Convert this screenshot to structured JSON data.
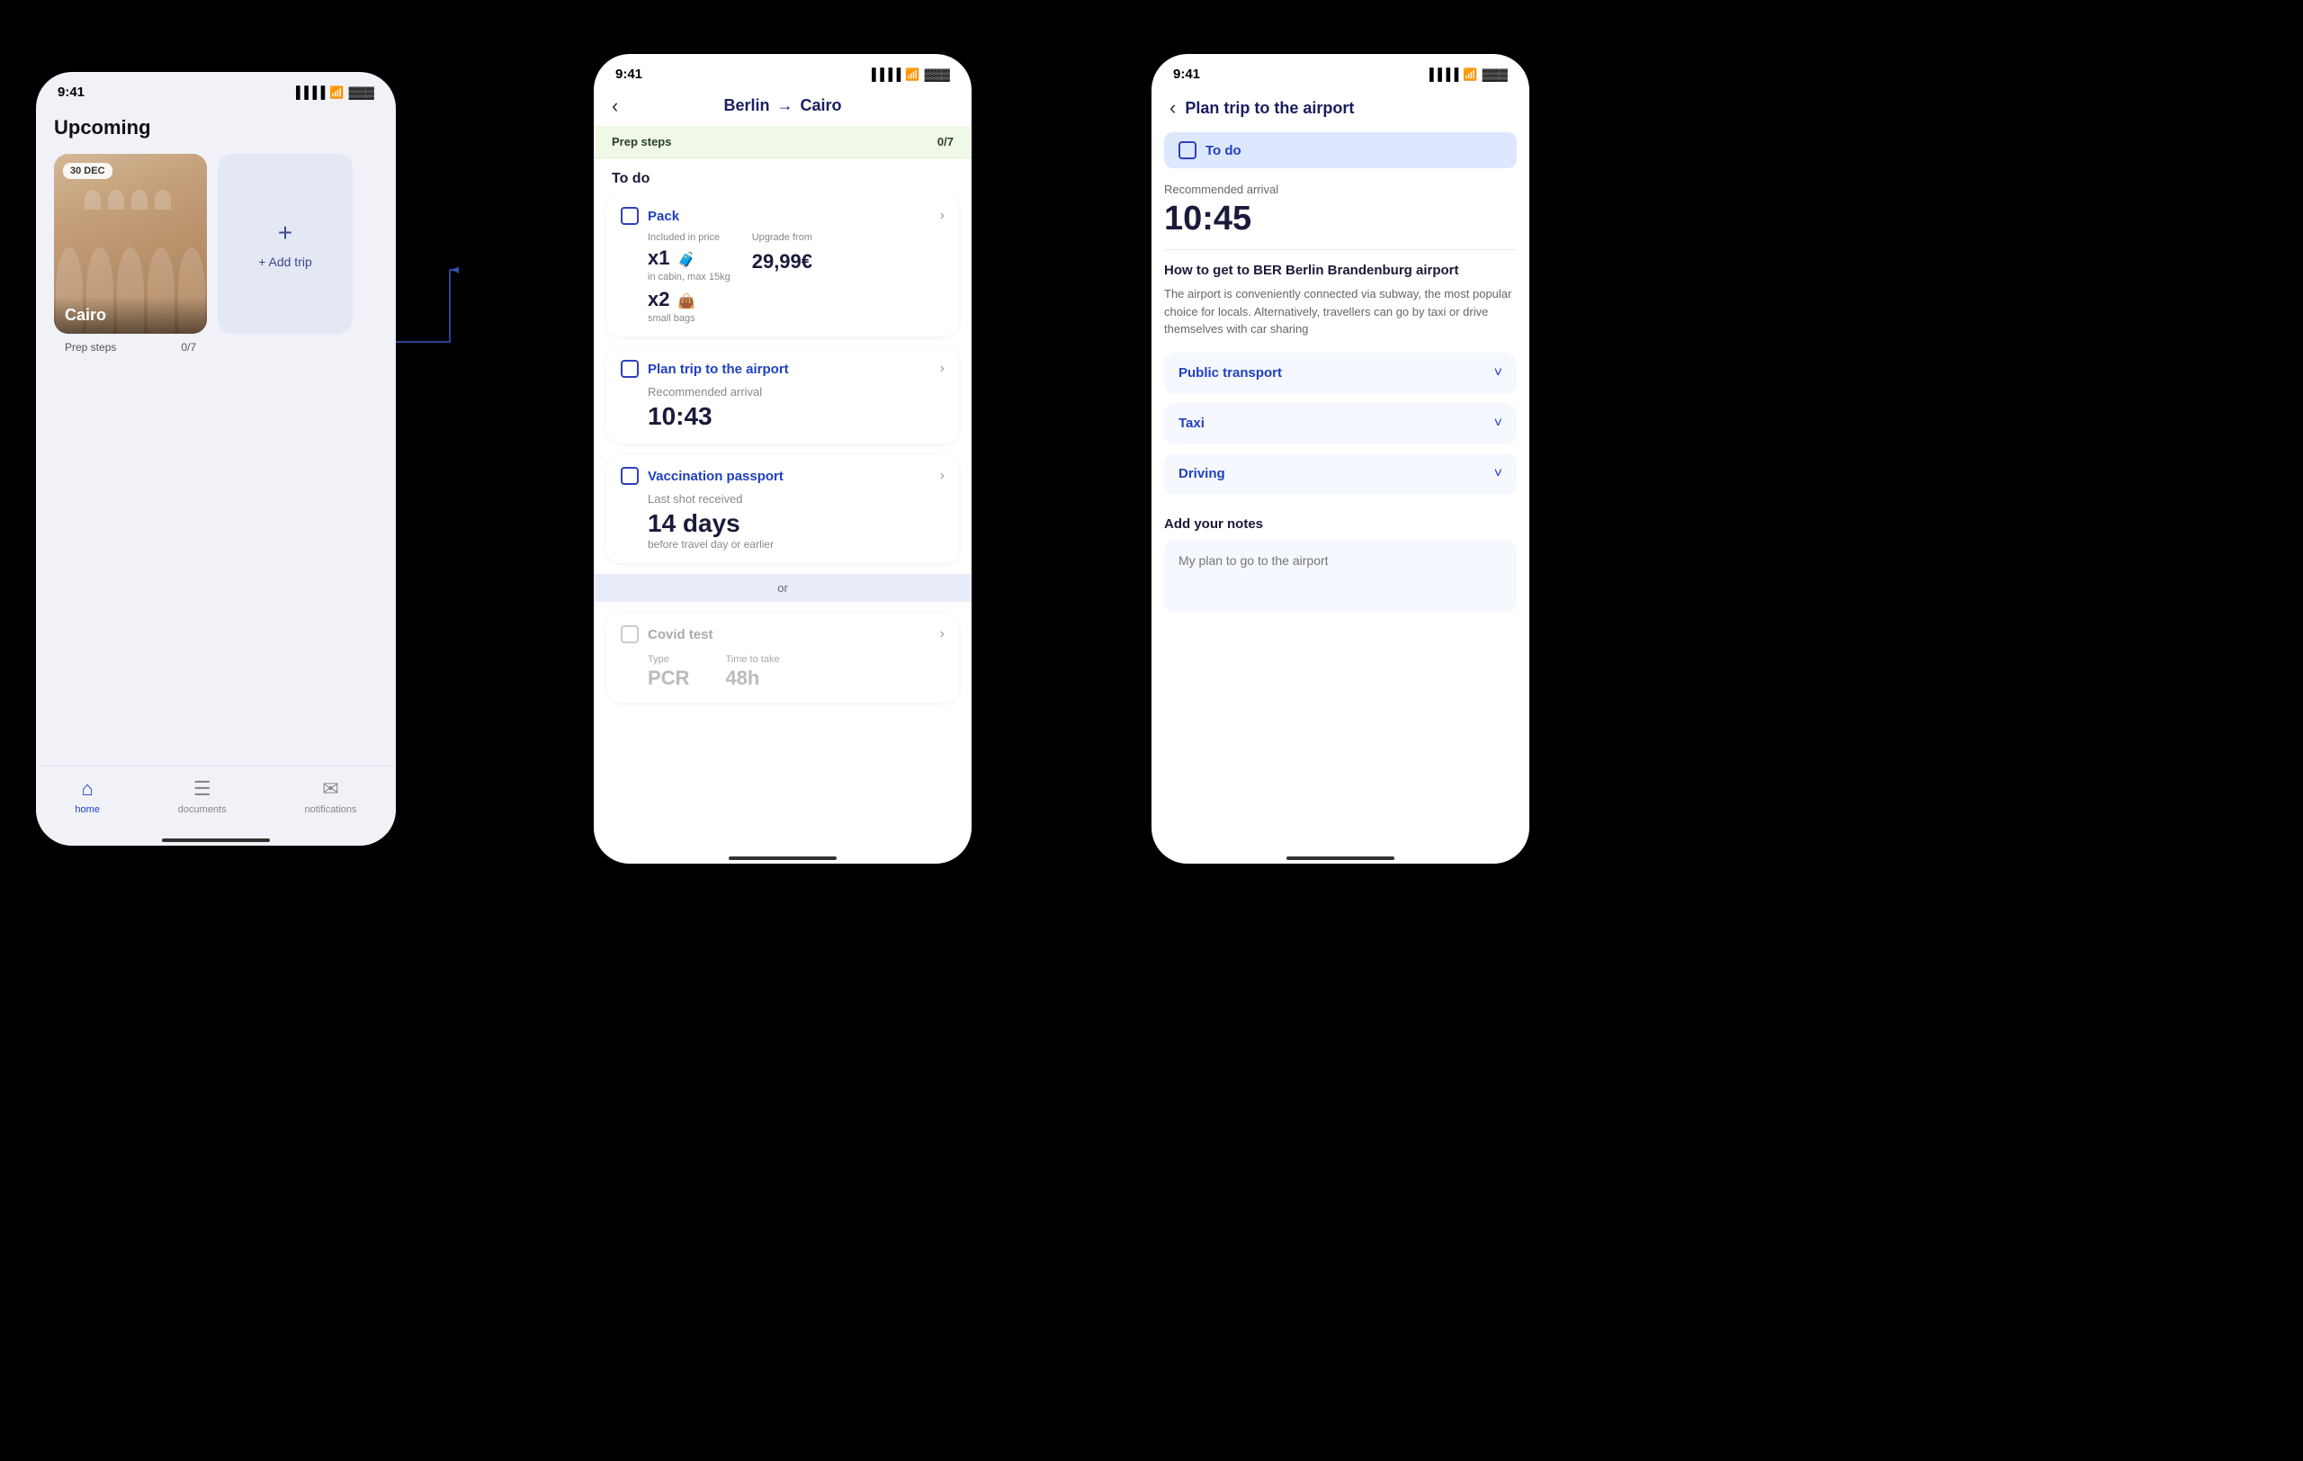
{
  "screen1": {
    "status_time": "9:41",
    "section_title": "Upcoming",
    "trip": {
      "date": "30 DEC",
      "name": "Cairo",
      "prep_steps_label": "Prep steps",
      "prep_steps_count": "0/7"
    },
    "add_trip_label": "+ Add trip",
    "nav": {
      "home": "home",
      "documents": "documents",
      "notifications": "notifications"
    }
  },
  "screen2": {
    "status_time": "9:41",
    "route_from": "Berlin",
    "route_to": "Cairo",
    "prep_steps_label": "Prep steps",
    "prep_steps_count": "0/7",
    "todo_title": "To do",
    "tasks": [
      {
        "id": "pack",
        "title": "Pack",
        "included_label": "Included in price",
        "upgrade_label": "Upgrade from",
        "x1_amount": "x1",
        "x1_sub": "in cabin, max 15kg",
        "x2_amount": "x2",
        "x2_sub": "small bags",
        "upgrade_price": "29,99€"
      },
      {
        "id": "airport",
        "title": "Plan trip to the airport",
        "rec_label": "Recommended arrival",
        "rec_time": "10:43"
      },
      {
        "id": "vaccination",
        "title": "Vaccination passport",
        "last_shot_label": "Last shot received",
        "days": "14 days",
        "days_sub": "before travel day or earlier"
      }
    ],
    "or_label": "or",
    "covid": {
      "title": "Covid test",
      "type_label": "Type",
      "time_label": "Time to take",
      "type_val": "PCR",
      "time_val": "48h"
    }
  },
  "screen3": {
    "status_time": "9:41",
    "title": "Plan trip to the airport",
    "todo_label": "To do",
    "rec_label": "Recommended arrival",
    "rec_time": "10:45",
    "how_title": "How to get to BER Berlin Brandenburg airport",
    "how_desc": "The airport is conveniently connected via subway, the most popular choice for locals. Alternatively, travellers can go by taxi or drive themselves with car sharing",
    "transport_options": [
      {
        "label": "Public transport"
      },
      {
        "label": "Taxi"
      },
      {
        "label": "Driving"
      }
    ],
    "notes_title": "Add your notes",
    "notes_placeholder": "My plan to go to the airport"
  }
}
